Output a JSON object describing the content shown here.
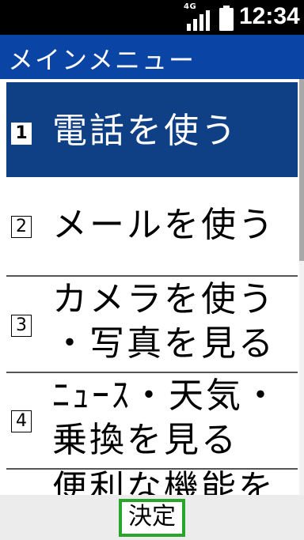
{
  "status": {
    "network": "4G",
    "time": "12:34"
  },
  "header": {
    "title": "メインメニュー"
  },
  "menu": {
    "items": [
      {
        "number": "1",
        "lines": [
          "電話を使う"
        ]
      },
      {
        "number": "2",
        "lines": [
          "メールを使う"
        ]
      },
      {
        "number": "3",
        "lines": [
          "カメラを使う",
          "・写真を見る"
        ]
      },
      {
        "number": "4",
        "lines": [
          "ﾆｭｰｽ・天気・",
          "乗換を見る"
        ]
      },
      {
        "number": "",
        "lines": [
          "便利な機能を"
        ]
      }
    ],
    "selected_index": 0
  },
  "softkey": {
    "center_label": "決定"
  },
  "colors": {
    "header_bg": "#0a45a6",
    "selected_bg": "#0f3f84",
    "softkey_border": "#2aa52c"
  },
  "icons": {
    "signal": "signal-bars-icon",
    "battery": "battery-icon"
  }
}
